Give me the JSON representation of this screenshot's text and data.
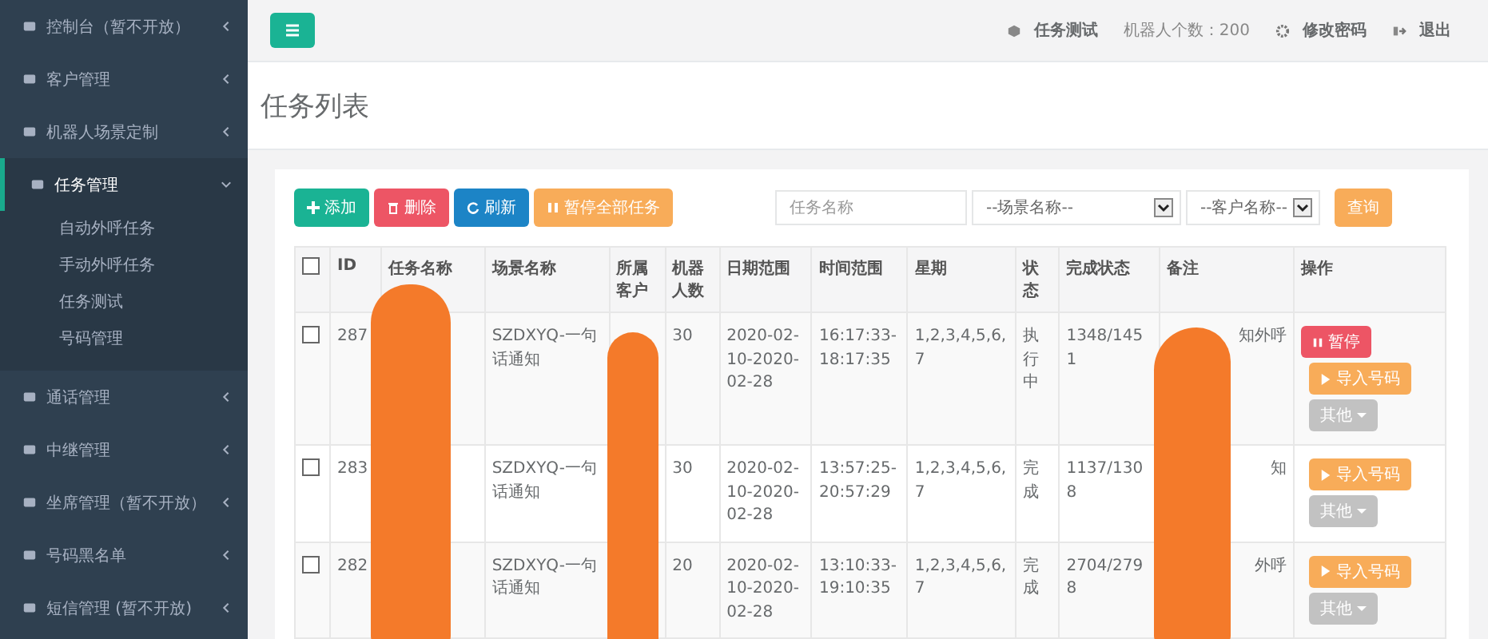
{
  "sidebar": {
    "items": [
      {
        "label": "控制台（暂不开放）",
        "expanded": false
      },
      {
        "label": "客户管理",
        "expanded": false
      },
      {
        "label": "机器人场景定制",
        "expanded": false
      },
      {
        "label": "任务管理",
        "expanded": true,
        "children": [
          {
            "label": "自动外呼任务"
          },
          {
            "label": "手动外呼任务"
          },
          {
            "label": "任务测试"
          },
          {
            "label": "号码管理"
          }
        ]
      },
      {
        "label": "通话管理",
        "expanded": false
      },
      {
        "label": "中继管理",
        "expanded": false
      },
      {
        "label": "坐席管理（暂不开放）",
        "expanded": false
      },
      {
        "label": "号码黑名单",
        "expanded": false
      },
      {
        "label": "短信管理 (暂不开放)",
        "expanded": false
      }
    ]
  },
  "topbar": {
    "links": [
      {
        "kind": "test",
        "label": "任务测试"
      },
      {
        "kind": "count",
        "label": "机器人个数：200"
      },
      {
        "kind": "password",
        "label": "修改密码"
      },
      {
        "kind": "logout",
        "label": "退出"
      }
    ]
  },
  "page_title": "任务列表",
  "toolbar": {
    "buttons": [
      {
        "kind": "add",
        "label": "添加"
      },
      {
        "kind": "delete",
        "label": "删除"
      },
      {
        "kind": "refresh",
        "label": "刷新"
      },
      {
        "kind": "pause",
        "label": "暂停全部任务"
      }
    ],
    "search": {
      "placeholder": "任务名称"
    },
    "selects": [
      "--场景名称--",
      "--客户名称--"
    ],
    "query": "查询"
  },
  "table": {
    "select_all_checked": false,
    "columns": [
      "ID",
      "任务名称",
      "场景名称",
      "所属客户",
      "机器人数",
      "日期范围",
      "时间范围",
      "星期",
      "状态",
      "完成状态",
      "备注",
      "操作"
    ],
    "rows": [
      {
        "checked": false,
        "cells": [
          "287",
          "",
          "SZDXYQ-一句话通知",
          "",
          "30",
          "2020-02-10-2020-02-28",
          "16:17:33-18:17:35",
          "1,2,3,4,5,6,7",
          "执行中",
          "1348/1451",
          "知外呼"
        ],
        "actions": [
          {
            "kind": "pause",
            "label": "暂停"
          },
          {
            "kind": "import",
            "label": "导入号码"
          },
          {
            "kind": "other",
            "label": "其他"
          }
        ]
      },
      {
        "checked": false,
        "cells": [
          "283",
          "",
          "SZDXYQ-一句话通知",
          "",
          "30",
          "2020-02-10-2020-02-28",
          "13:57:25-20:57:29",
          "1,2,3,4,5,6,7",
          "完成",
          "1137/1308",
          "知"
        ],
        "actions": [
          {
            "kind": "import",
            "label": "导入号码"
          },
          {
            "kind": "other",
            "label": "其他"
          }
        ]
      },
      {
        "checked": false,
        "cells": [
          "282",
          "",
          "SZDXYQ-一句话通知",
          "",
          "20",
          "2020-02-10-2020-02-28",
          "13:10:33-19:10:35",
          "1,2,3,4,5,6,7",
          "完成",
          "2704/2798",
          "外呼"
        ],
        "actions": [
          {
            "kind": "import",
            "label": "导入号码"
          },
          {
            "kind": "other",
            "label": "其他"
          }
        ]
      }
    ]
  }
}
